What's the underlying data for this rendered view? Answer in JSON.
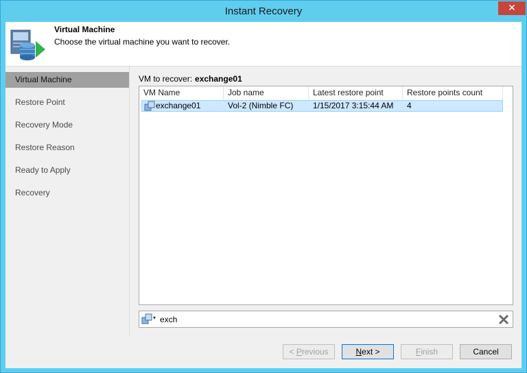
{
  "window": {
    "title": "Instant Recovery",
    "close_glyph": "✕"
  },
  "header": {
    "title": "Virtual Machine",
    "subtitle": "Choose the virtual machine you want to recover.",
    "icon": "vm-database-arrow-icon"
  },
  "sidebar": {
    "items": [
      {
        "label": "Virtual Machine",
        "active": true
      },
      {
        "label": "Restore Point"
      },
      {
        "label": "Recovery Mode"
      },
      {
        "label": "Restore Reason"
      },
      {
        "label": "Ready to Apply"
      },
      {
        "label": "Recovery"
      }
    ]
  },
  "main": {
    "vm_label": "VM to recover:",
    "vm_value": "exchange01",
    "columns": [
      "VM Name",
      "Job name",
      "Latest restore point",
      "Restore points count"
    ],
    "rows": [
      {
        "vm_name": "exchange01",
        "job_name": "Vol-2 (Nimble FC)",
        "latest": "1/15/2017 3:15:44 AM",
        "count": "4",
        "selected": true
      }
    ],
    "filter": {
      "value": "exch",
      "caret": "▾"
    }
  },
  "buttons": {
    "previous": {
      "pre": "< ",
      "accel": "P",
      "post": "revious",
      "enabled": false
    },
    "next": {
      "pre": "",
      "accel": "N",
      "post": "ext >",
      "enabled": true
    },
    "finish": {
      "pre": "",
      "accel": "F",
      "post": "inish",
      "enabled": false
    },
    "cancel": {
      "label": "Cancel",
      "enabled": true
    }
  },
  "colors": {
    "titlebar": "#60cdef",
    "close": "#c7463c",
    "selection": "#cde8ff",
    "sidebar_active": "#a0a0a0"
  }
}
